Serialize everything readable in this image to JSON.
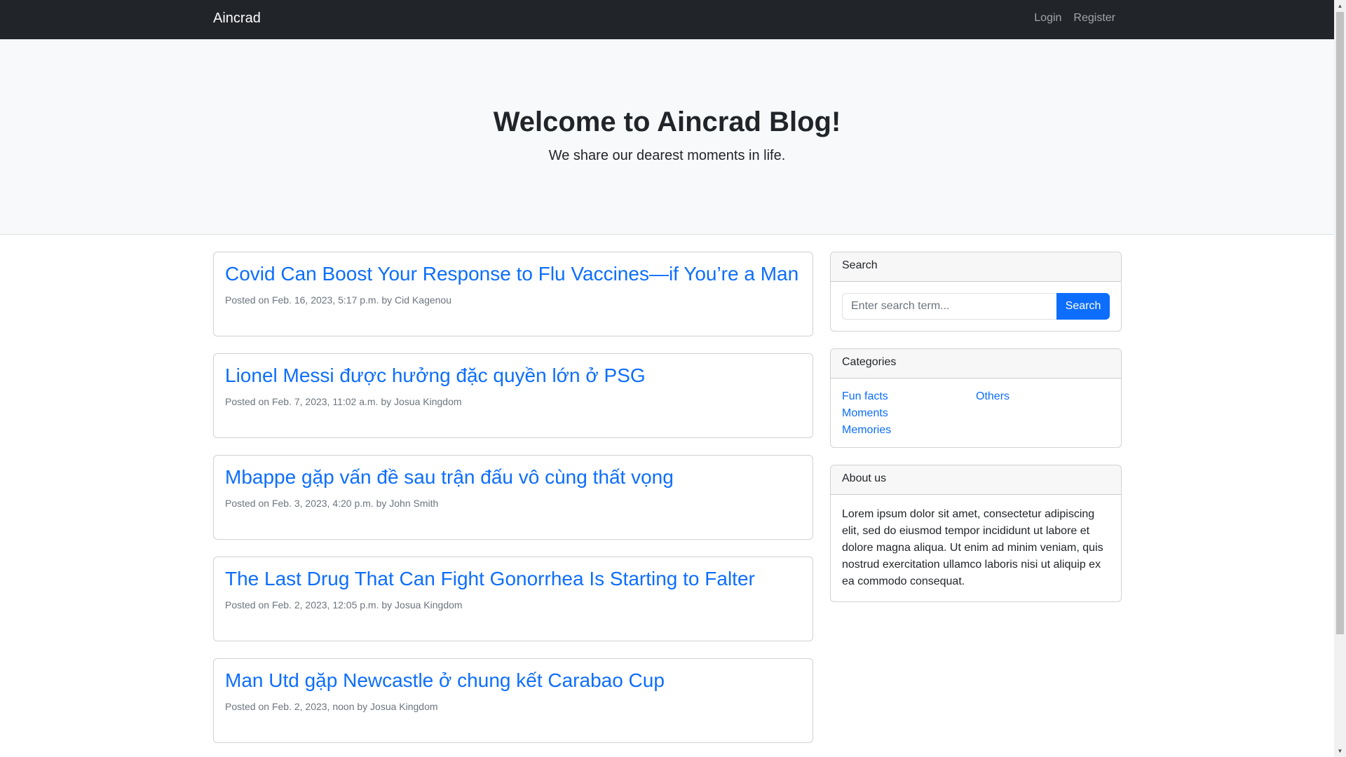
{
  "navbar": {
    "brand": "Aincrad",
    "links": [
      "Login",
      "Register"
    ]
  },
  "hero": {
    "title": "Welcome to Aincrad Blog!",
    "subtitle": "We share our dearest moments in life."
  },
  "posts": [
    {
      "title": "Covid Can Boost Your Response to Flu Vaccines—if You’re a Man",
      "meta": "Posted on Feb. 16, 2023, 5:17 p.m. by Cid Kagenou"
    },
    {
      "title": "Lionel Messi được hưởng đặc quyền lớn ở PSG",
      "meta": "Posted on Feb. 7, 2023, 11:02 a.m. by Josua Kingdom"
    },
    {
      "title": "Mbappe gặp vấn đề sau trận đấu vô cùng thất vọng",
      "meta": "Posted on Feb. 3, 2023, 4:20 p.m. by John Smith"
    },
    {
      "title": "The Last Drug That Can Fight Gonorrhea Is Starting to Falter",
      "meta": "Posted on Feb. 2, 2023, 12:05 p.m. by Josua Kingdom"
    },
    {
      "title": "Man Utd gặp Newcastle ở chung kết Carabao Cup",
      "meta": "Posted on Feb. 2, 2023, noon by Josua Kingdom"
    }
  ],
  "sidebar": {
    "search": {
      "header": "Search",
      "placeholder": "Enter search term...",
      "button": "Search"
    },
    "categories": {
      "header": "Categories",
      "col1": [
        "Fun facts",
        "Moments",
        "Memories"
      ],
      "col2": [
        "Others"
      ]
    },
    "about": {
      "header": "About us",
      "text": "Lorem ipsum dolor sit amet, consectetur adipiscing elit, sed do eiusmod tempor incididunt ut labore et dolore magna aliqua. Ut enim ad minim veniam, quis nostrud exercitation ullamco laboris nisi ut aliquip ex ea commodo consequat."
    }
  },
  "colors": {
    "navbar_bg": "#212529",
    "link": "#0d6efd",
    "hero_bg": "#f8f9fa",
    "muted": "#6c757d"
  },
  "icons": {
    "scroll_up": "scroll-up-arrow-icon",
    "scroll_down": "scroll-down-arrow-icon"
  }
}
